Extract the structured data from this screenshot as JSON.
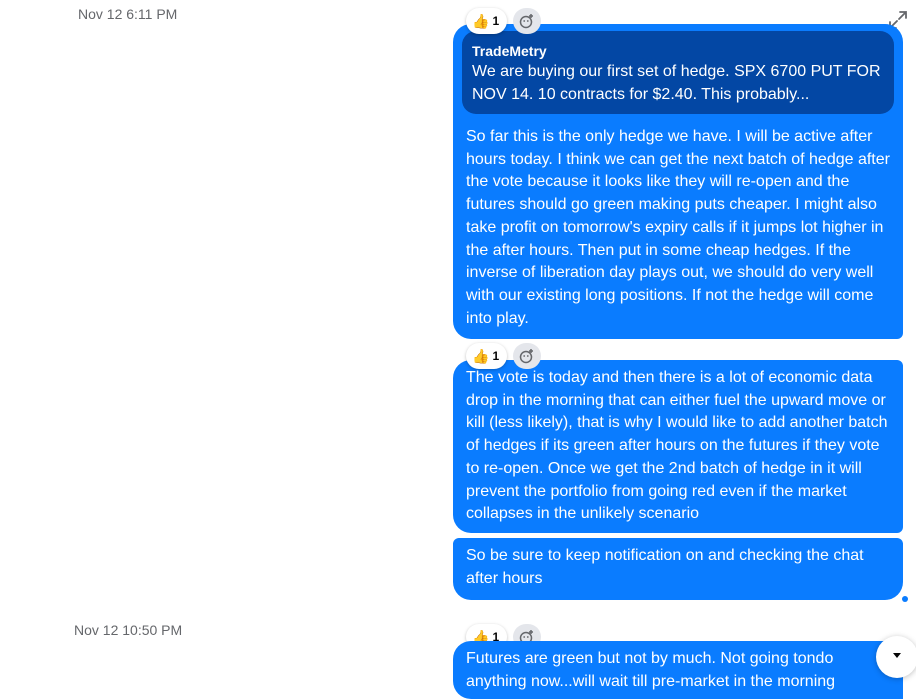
{
  "timestamps": [
    "Nov 12 6:11 PM",
    "Nov 12 10:50 PM"
  ],
  "reactions": {
    "emoji": "thumbs-up",
    "count": "1"
  },
  "messages": [
    {
      "quote": {
        "author": "TradeMetry",
        "text": "We are buying our first set of hedge. SPX 6700 PUT FOR NOV 14. 10 contracts for $2.40. This probably..."
      },
      "text": "So far this is the only hedge we have. I will be active after hours today. I think we can get the next batch of hedge after the vote because it looks like they will re-open and the futures should go green making puts cheaper. I might also take profit on tomorrow's expiry calls if it jumps lot higher in the after hours. Then put in some cheap hedges. If the inverse of liberation day plays out, we should do very well with our existing long positions. If not the hedge will come into play."
    },
    {
      "text": "The vote is today and then there is a lot of economic data drop in the morning that can either fuel the upward move or kill (less likely), that is why I would like to add another batch of hedges if its green after hours on the futures if they vote to re-open. Once we get the 2nd batch of hedge in it will prevent the portfolio from going red even if the market collapses in the unlikely scenario"
    },
    {
      "text": "So be sure to keep notification on and checking the chat after hours"
    },
    {
      "text": "Futures are green but not by much. Not going tondo anything now...will wait till pre-market in the morning"
    }
  ],
  "icons": {
    "expand": "expand-arrows-icon",
    "add_reaction": "add-reaction-icon",
    "scroll_down": "chevron-down-icon",
    "seen": "seen-dot"
  },
  "colors": {
    "bubble": "#0a7cff",
    "quote": "#0347a4",
    "timestamp": "#65676b"
  }
}
